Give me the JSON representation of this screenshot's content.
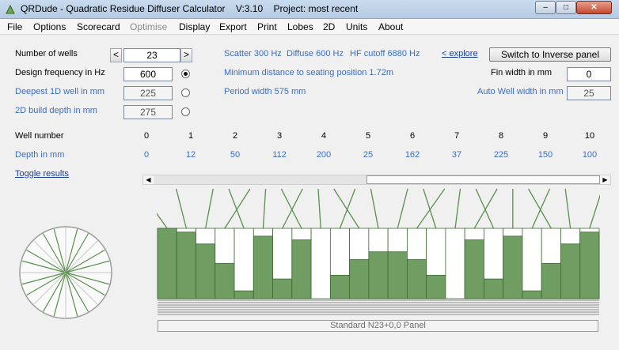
{
  "window": {
    "title": "QRDude - Quadratic Residue Diffuser Calculator    V:3.10    Project: most recent",
    "minimize": "–",
    "maximize": "□",
    "close": "✕"
  },
  "menu": [
    "File",
    "Options",
    "Scorecard",
    "Optimise",
    "Display",
    "Export",
    "Print",
    "Lobes",
    "2D",
    "Units",
    "About"
  ],
  "menu_disabled": [
    "Optimise"
  ],
  "left": {
    "number_of_wells_label": "Number of wells",
    "number_of_wells": "23",
    "decrement": "<",
    "increment": ">",
    "design_frequency_label": "Design frequency in Hz",
    "design_frequency": "600",
    "deepest_well_label": "Deepest 1D well in mm",
    "deepest_well": "225",
    "build_depth_label": "2D build depth in mm",
    "build_depth": "275",
    "selected_radio": "design_frequency"
  },
  "info": {
    "scatter": "Scatter 300 Hz",
    "diffuse": "Diffuse 600 Hz",
    "hf_cutoff": "HF cutoff 6880 Hz",
    "explore": "< explore",
    "min_distance": "Minimum distance to seating position  1.72m",
    "period_width": "Period width  575 mm"
  },
  "right": {
    "switch_button": "Switch to Inverse panel",
    "fin_width_label": "Fin width in mm",
    "fin_width": "0",
    "auto_well_label": "Auto Well width in mm",
    "auto_well": "25"
  },
  "table": {
    "well_label": "Well number",
    "depth_label": "Depth in mm",
    "wells": [
      "0",
      "1",
      "2",
      "3",
      "4",
      "5",
      "6",
      "7",
      "8",
      "9",
      "10"
    ],
    "depths": [
      "0",
      "12",
      "50",
      "112",
      "200",
      "25",
      "162",
      "37",
      "225",
      "150",
      "100"
    ]
  },
  "toggle_results": "Toggle results",
  "scroll": {
    "left_arrow": "◀",
    "right_arrow": "▶"
  },
  "diffuser": {
    "wells": 23,
    "max_depth_mm": 225,
    "well_depths_mm": [
      0,
      12,
      50,
      112,
      200,
      25,
      162,
      37,
      225,
      150,
      100,
      75,
      75,
      100,
      150,
      225,
      37,
      162,
      25,
      200,
      112,
      50,
      12
    ],
    "colors": {
      "fill": "#6f9d62",
      "edge": "#3f6a34",
      "ray": "#5a8f4d"
    }
  },
  "panel_label": "Standard N23+0,0 Panel",
  "colors": {
    "accent_blue": "#3a6fc4",
    "panel_green": "#6f9d62"
  }
}
